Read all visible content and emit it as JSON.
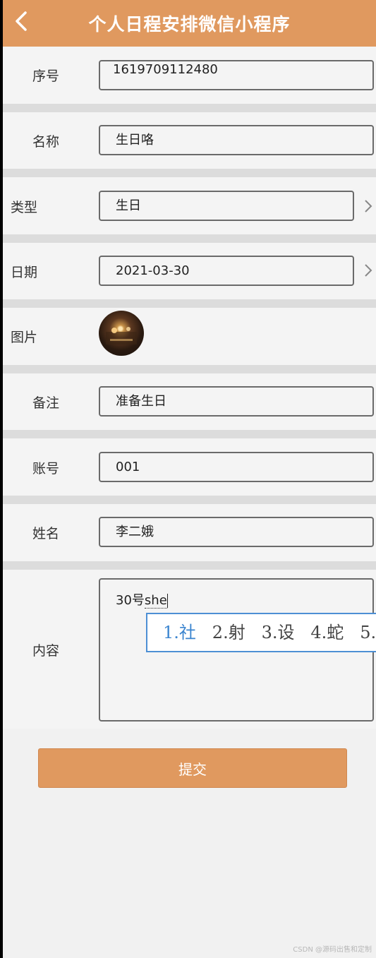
{
  "header": {
    "title": "个人日程安排微信小程序",
    "back_icon": "chevron-left-icon"
  },
  "form": {
    "id_label": "序号",
    "id_value": "1619709112480",
    "name_label": "名称",
    "name_value": "生日咯",
    "type_label": "类型",
    "type_value": "生日",
    "date_label": "日期",
    "date_value": "2021-03-30",
    "image_label": "图片",
    "remark_label": "备注",
    "remark_value": "准备生日",
    "account_label": "账号",
    "account_value": "001",
    "username_label": "姓名",
    "username_value": "李二娥",
    "content_label": "内容",
    "content_prefix": "30号",
    "content_composing": "she"
  },
  "ime": {
    "candidates": [
      "1.社",
      "2.射",
      "3.设",
      "4.蛇",
      "5."
    ]
  },
  "submit_label": "提交",
  "watermark": "CSDN @源码出售和定制"
}
